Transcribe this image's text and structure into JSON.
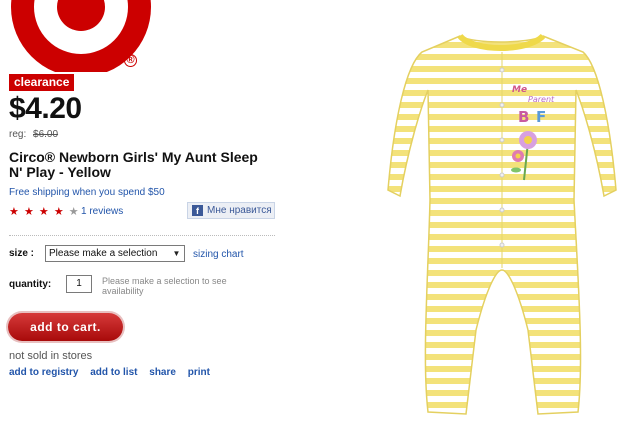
{
  "brand": {
    "registered_mark": "®"
  },
  "badge": {
    "label": "clearance"
  },
  "price": {
    "current": "$4.20",
    "reg_label": "reg:",
    "reg_value": "$6.00"
  },
  "product": {
    "title_line1": "Circo® Newborn Girls' My Aunt Sleep",
    "title_line2": "N' Play - Yellow",
    "shipping_text": "Free shipping when you spend $50",
    "image_text_1": "Me",
    "image_text_2": "Parent",
    "image_text_3": "B",
    "image_text_4": "F"
  },
  "rating": {
    "filled_stars": 4,
    "total_stars": 5,
    "reviews_label": "1 reviews"
  },
  "facebook": {
    "icon": "f",
    "like_label": "Мне нравится"
  },
  "size": {
    "label": "size :",
    "selected": "Please make a selection",
    "chart_link": "sizing chart"
  },
  "quantity": {
    "label": "quantity:",
    "value": "1",
    "note": "Please make a selection to see availability"
  },
  "cart": {
    "button_label": "add to cart."
  },
  "store": {
    "availability": "not sold in stores"
  },
  "actions": {
    "registry": "add to registry",
    "list": "add to list",
    "share": "share",
    "print": "print"
  },
  "colors": {
    "brand_red": "#cc0000",
    "link_blue": "#2255aa",
    "stripe_yellow": "#f3e27a"
  }
}
